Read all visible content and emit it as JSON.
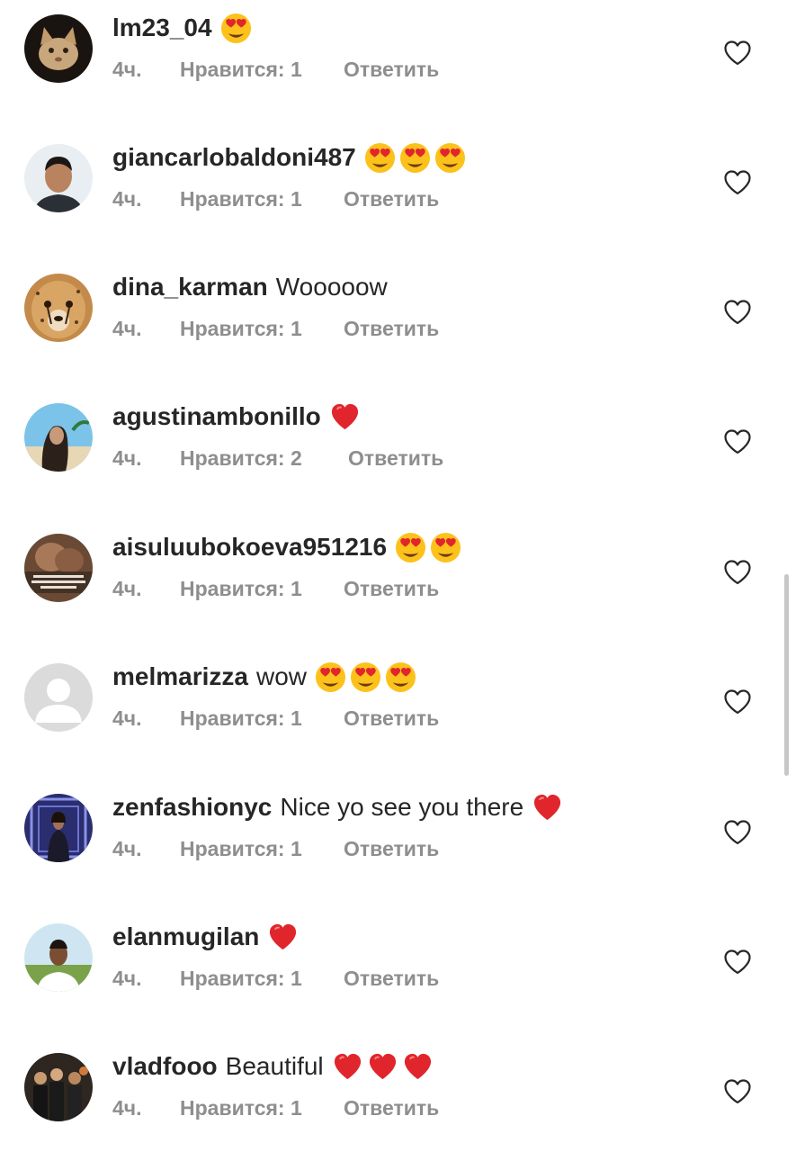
{
  "colors": {
    "text": "#262626",
    "meta": "#8e8e8e",
    "heart_red": "#e0262c",
    "emoji_yellow": "#fcc21b"
  },
  "comments": [
    {
      "username": "lm23_04",
      "text": "",
      "emojis": [
        "heart-eyes"
      ],
      "time": "4ч.",
      "likes": "Нравится: 1",
      "reply": "Ответить",
      "avatar": "cat"
    },
    {
      "username": "giancarlobaldoni487",
      "text": "",
      "emojis": [
        "heart-eyes",
        "heart-eyes",
        "heart-eyes"
      ],
      "time": "4ч.",
      "likes": "Нравится: 1",
      "reply": "Ответить",
      "avatar": "man-portrait"
    },
    {
      "username": "dina_karman",
      "text": "Wooooow",
      "emojis": [],
      "time": "4ч.",
      "likes": "Нравится: 1",
      "reply": "Ответить",
      "avatar": "cheetah"
    },
    {
      "username": "agustinambonillo",
      "text": "",
      "emojis": [
        "red-heart"
      ],
      "time": "4ч.",
      "likes": "Нравится: 2",
      "reply": "Ответить",
      "avatar": "woman-beach"
    },
    {
      "username": "aisuluubokoeva951216",
      "text": "",
      "emojis": [
        "heart-eyes",
        "heart-eyes"
      ],
      "time": "4ч.",
      "likes": "Нравится: 1",
      "reply": "Ответить",
      "avatar": "couple-quote"
    },
    {
      "username": "melmarizza",
      "text": "wow",
      "emojis": [
        "heart-eyes",
        "heart-eyes",
        "heart-eyes"
      ],
      "time": "4ч.",
      "likes": "Нравится: 1",
      "reply": "Ответить",
      "avatar": "default-user"
    },
    {
      "username": "zenfashionyc",
      "text": "Nice yo see you there",
      "emojis": [
        "red-heart"
      ],
      "time": "4ч.",
      "likes": "Нравится: 1",
      "reply": "Ответить",
      "avatar": "woman-stage"
    },
    {
      "username": "elanmugilan",
      "text": "",
      "emojis": [
        "red-heart"
      ],
      "time": "4ч.",
      "likes": "Нравится: 1",
      "reply": "Ответить",
      "avatar": "man-field"
    },
    {
      "username": "vladfooo",
      "text": "Beautiful",
      "emojis": [
        "red-heart",
        "red-heart",
        "red-heart"
      ],
      "time": "4ч.",
      "likes": "Нравится: 1",
      "reply": "Ответить",
      "avatar": "group-photo"
    }
  ]
}
